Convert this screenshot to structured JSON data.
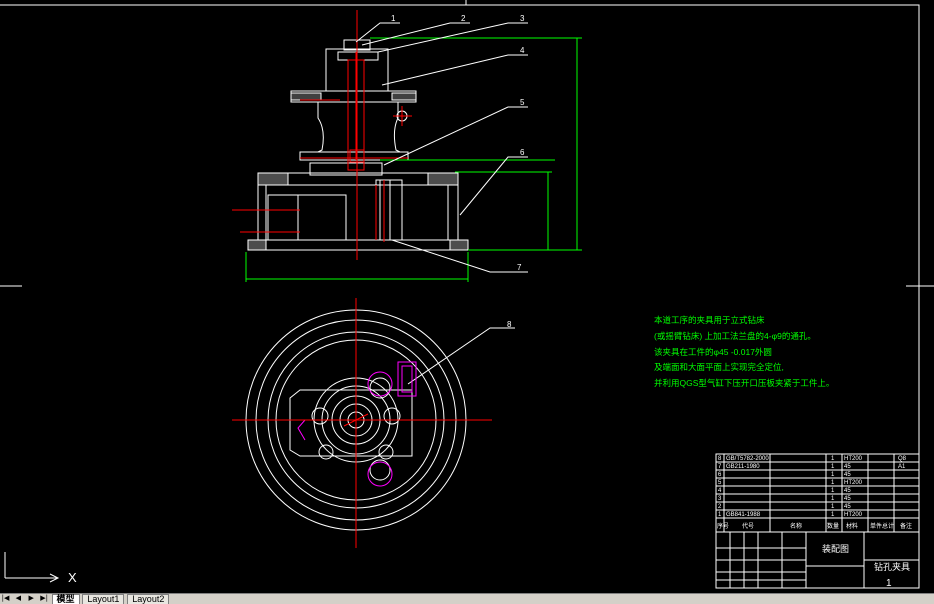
{
  "drawing": {
    "part_numbers": [
      "1",
      "2",
      "3",
      "4",
      "5",
      "6",
      "7",
      "8"
    ],
    "notes": [
      "本道工序的夹具用于立式钻床",
      "(或摇臂钻床) 上加工法兰盘的4-φ9的通孔。",
      "该夹具在工件的φ45 -0.017外圆",
      "及端面和大面平面上实现完全定位,",
      "并利用QGS型气缸下压开口压板夹紧于工件上。"
    ],
    "colors": {
      "background": "#000000",
      "lines": "#ffffff",
      "centerlines": "#ff0000",
      "dimensions": "#00ff00",
      "notes": "#00ff00",
      "hidden": "#ff00ff"
    }
  },
  "title_block": {
    "drawing_name": "装配图",
    "part_name": "钻孔夹具",
    "sheet": "1",
    "headers": [
      "序号",
      "代号",
      "名称",
      "数量",
      "材料",
      "单件总计",
      "备注"
    ],
    "rows": [
      {
        "no": "8",
        "code": "GB/T5782-2000",
        "name": "",
        "qty": "1",
        "mat": "HT200",
        "note": "Q8"
      },
      {
        "no": "7",
        "code": "GB211-1980",
        "name": "",
        "qty": "1",
        "mat": "45",
        "note": "A1"
      },
      {
        "no": "6",
        "code": "",
        "name": "",
        "qty": "1",
        "mat": "45",
        "note": ""
      },
      {
        "no": "5",
        "code": "",
        "name": "",
        "qty": "1",
        "mat": "HT200",
        "note": ""
      },
      {
        "no": "4",
        "code": "",
        "name": "",
        "qty": "1",
        "mat": "45",
        "note": ""
      },
      {
        "no": "3",
        "code": "",
        "name": "",
        "qty": "1",
        "mat": "45",
        "note": ""
      },
      {
        "no": "2",
        "code": "",
        "name": "",
        "qty": "1",
        "mat": "45",
        "note": ""
      },
      {
        "no": "1",
        "code": "GB841-1988",
        "name": "",
        "qty": "1",
        "mat": "HT200",
        "note": ""
      }
    ]
  },
  "model_space": {
    "x_label": "X"
  },
  "tabs": [
    {
      "label": "模型",
      "active": true
    },
    {
      "label": "Layout1",
      "active": false
    },
    {
      "label": "Layout2",
      "active": false
    }
  ]
}
